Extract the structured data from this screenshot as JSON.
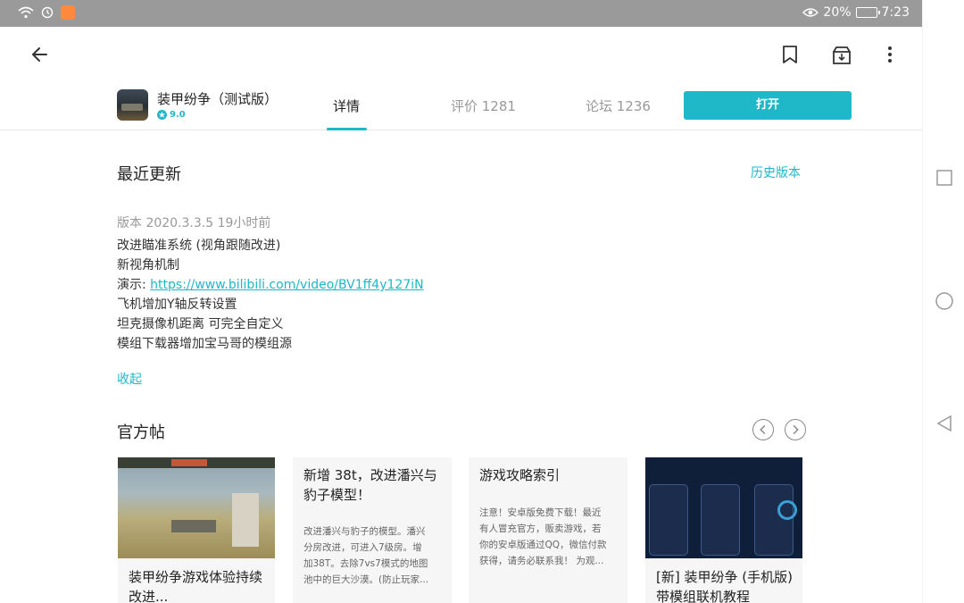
{
  "status_bar": {
    "battery": "20%",
    "time": "7:23"
  },
  "app": {
    "name": "装甲纷争（测试版）",
    "rating": "9.0"
  },
  "tabs": {
    "details": "详情",
    "reviews": "评价 1281",
    "forum": "论坛 1236"
  },
  "open_button": "打开",
  "recent_updates": {
    "title": "最近更新",
    "history_link": "历史版本",
    "version_line": "版本 2020.3.3.5   19小时前",
    "notes": {
      "line1": "改进瞄准系统 (视角跟随改进)",
      "line2": "新视角机制",
      "demo_prefix": "演示: ",
      "demo_link": "https://www.bilibili.com/video/BV1ff4y127iN",
      "line4": "飞机增加Y轴反转设置",
      "line5": "坦克摄像机距离 可完全自定义",
      "line6": "模组下载器增加宝马哥的模组源"
    },
    "collapse": "收起"
  },
  "official_posts": {
    "title": "官方帖",
    "cards": [
      {
        "title_l1": "装甲纷争游戏体验持续",
        "title_l2": "改进..."
      },
      {
        "title_l1": "新增 38t，改进潘兴与",
        "title_l2": "豹子模型！",
        "desc": [
          "改进潘兴与豹子的模型。潘兴",
          "分房改进，可进入7级房。增",
          "加38T。去除7vs7模式的地图",
          "池中的巨大沙漠。(防止玩家..."
        ]
      },
      {
        "title_l1": "游戏攻略索引",
        "desc": [
          "注意！安卓版免费下载！最近",
          "有人冒充官方，贩卖游戏，若",
          "你的安卓版通过QQ，微信付款",
          "获得，请务必联系我！ 为观..."
        ]
      },
      {
        "title_l1": "[新] 装甲纷争 (手机版)",
        "title_l2": "带模组联机教程"
      }
    ]
  },
  "colors": {
    "accent": "#1fb8c8",
    "statusbar": "#9a9a9a"
  }
}
